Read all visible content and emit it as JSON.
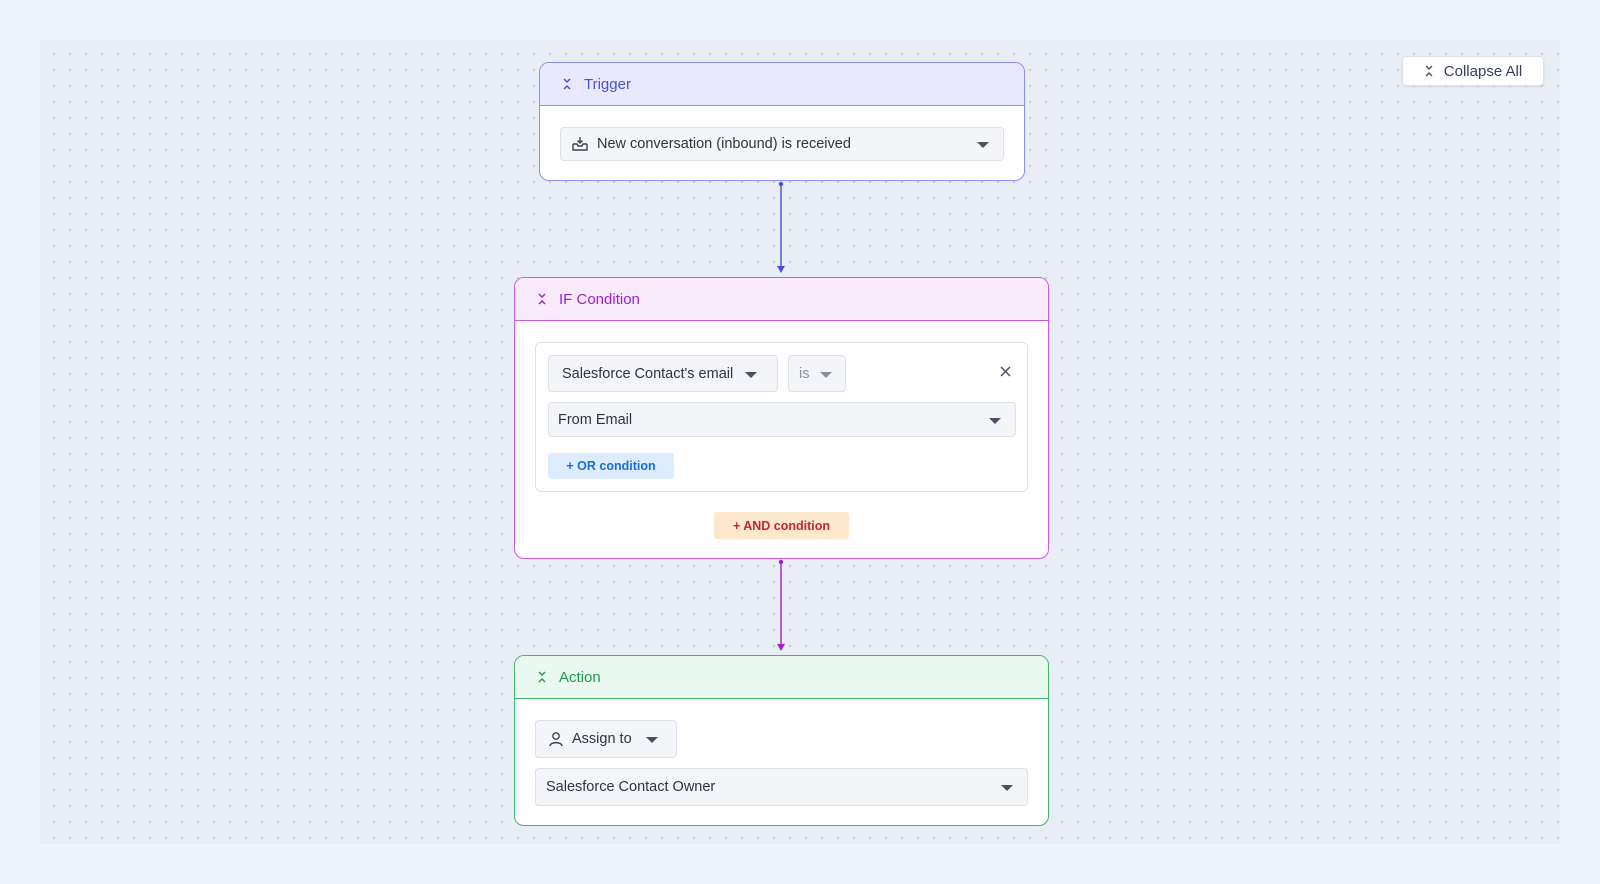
{
  "toolbar": {
    "collapse_all_label": "Collapse All"
  },
  "trigger": {
    "title": "Trigger",
    "event_value": "New conversation (inbound) is received"
  },
  "if_condition": {
    "title": "IF Condition",
    "field_value": "Salesforce Contact's email",
    "operator_value": "is",
    "compare_value": "From Email",
    "or_button_label": "+ OR condition",
    "and_button_label": "+ AND condition"
  },
  "action": {
    "title": "Action",
    "action_type_value": "Assign to",
    "target_value": "Salesforce Contact Owner"
  },
  "colors": {
    "trigger_accent": "#4a4fd6",
    "condition_accent": "#a020c8",
    "action_accent": "#1c9a4d",
    "or_button_text": "#1a6fd6",
    "and_button_text": "#c0263a"
  },
  "icons": {
    "collapse": "collapse-chevrons-icon",
    "trigger_event": "inbox-tray-icon",
    "action_type": "user-icon",
    "remove": "close-icon"
  }
}
